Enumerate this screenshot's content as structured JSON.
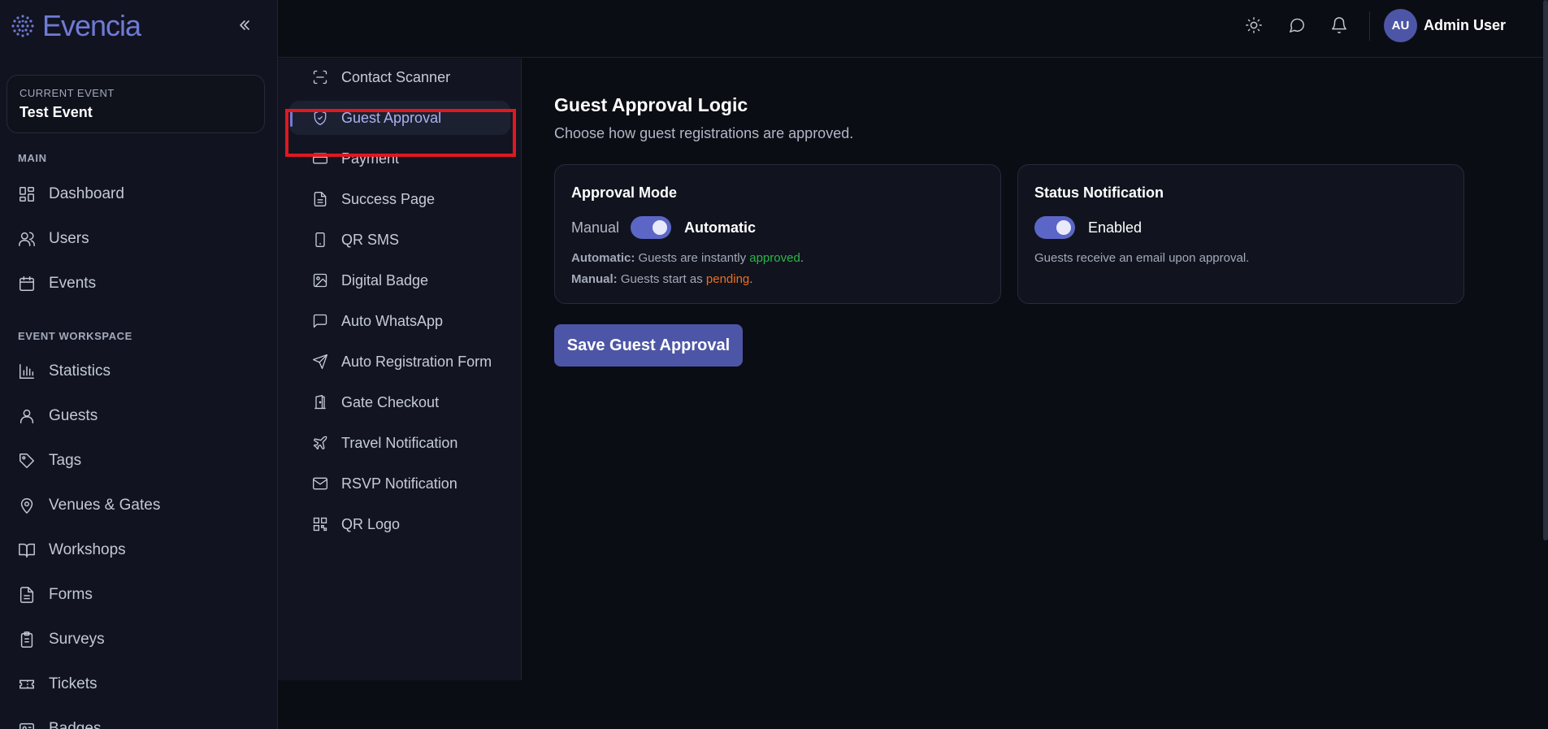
{
  "brand": {
    "name": "Evencia",
    "accent": "#6f7ad6"
  },
  "sidebar": {
    "current_event_caption": "CURRENT EVENT",
    "current_event_name": "Test Event",
    "section_main": "MAIN",
    "main_items": [
      {
        "label": "Dashboard",
        "icon": "dashboard-icon"
      },
      {
        "label": "Users",
        "icon": "users-icon"
      },
      {
        "label": "Events",
        "icon": "calendar-icon"
      }
    ],
    "section_workspace": "EVENT WORKSPACE",
    "workspace_items": [
      {
        "label": "Statistics",
        "icon": "bar-chart-icon"
      },
      {
        "label": "Guests",
        "icon": "user-icon"
      },
      {
        "label": "Tags",
        "icon": "tag-icon"
      },
      {
        "label": "Venues & Gates",
        "icon": "map-pin-icon"
      },
      {
        "label": "Workshops",
        "icon": "book-icon"
      },
      {
        "label": "Forms",
        "icon": "file-text-icon"
      },
      {
        "label": "Surveys",
        "icon": "clipboard-icon"
      },
      {
        "label": "Tickets",
        "icon": "ticket-icon"
      },
      {
        "label": "Badges",
        "icon": "badge-icon"
      }
    ]
  },
  "header": {
    "user_initials": "AU",
    "user_name": "Admin User"
  },
  "subnav": {
    "items": [
      {
        "label": "Contact Scanner",
        "icon": "scan-icon"
      },
      {
        "label": "Guest Approval",
        "icon": "shield-check-icon",
        "active": true
      },
      {
        "label": "Payment",
        "icon": "credit-card-icon"
      },
      {
        "label": "Success Page",
        "icon": "file-text-icon"
      },
      {
        "label": "QR SMS",
        "icon": "smartphone-icon"
      },
      {
        "label": "Digital Badge",
        "icon": "image-icon"
      },
      {
        "label": "Auto WhatsApp",
        "icon": "message-square-icon"
      },
      {
        "label": "Auto Registration Form",
        "icon": "send-icon"
      },
      {
        "label": "Gate Checkout",
        "icon": "door-icon"
      },
      {
        "label": "Travel Notification",
        "icon": "plane-icon"
      },
      {
        "label": "RSVP Notification",
        "icon": "mail-icon"
      },
      {
        "label": "QR Logo",
        "icon": "qr-code-icon"
      }
    ]
  },
  "main": {
    "title": "Guest Approval Logic",
    "subtitle": "Choose how guest registrations are approved.",
    "approval_card": {
      "title": "Approval Mode",
      "off_label": "Manual",
      "on_label": "Automatic",
      "toggle_on": true,
      "auto_key": "Automatic:",
      "auto_text": "Guests are instantly",
      "auto_status": "approved",
      "manual_key": "Manual:",
      "manual_text": "Guests start as",
      "manual_status": "pending",
      "period": "."
    },
    "notification_card": {
      "title": "Status Notification",
      "label": "Enabled",
      "toggle_on": true,
      "note": "Guests receive an email upon approval."
    },
    "save_label": "Save Guest Approval"
  },
  "colors": {
    "approved": "#2bb54a",
    "pending": "#f06d1f",
    "highlight": "#e0181f"
  }
}
